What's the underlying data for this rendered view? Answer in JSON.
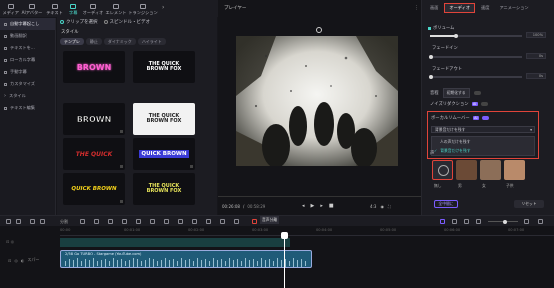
{
  "top_menu": [
    {
      "label": "メディア",
      "icon": "media-icon"
    },
    {
      "label": "AIアバター",
      "icon": "ai-avatar-icon"
    },
    {
      "label": "テキスト",
      "icon": "text-icon"
    },
    {
      "label": "字幕",
      "icon": "subtitle-icon"
    },
    {
      "label": "オーディオ",
      "icon": "audio-icon"
    },
    {
      "label": "エレメント",
      "icon": "element-icon"
    },
    {
      "label": "トランジション",
      "icon": "transition-icon"
    }
  ],
  "sidebar": {
    "items": [
      {
        "label": "自動字幕起こし"
      },
      {
        "label": "動画翻訳"
      },
      {
        "label": "テキストを..."
      },
      {
        "label": "ローカル字幕"
      },
      {
        "label": "手動字幕"
      },
      {
        "label": "カスタマイズ"
      },
      {
        "label": "スタイル"
      },
      {
        "label": "テキスト編集"
      }
    ]
  },
  "mid": {
    "radio_clip": "クリップを選択",
    "radio_speed": "スピンドル・ビデオ",
    "section_label": "スタイル",
    "filters": [
      "テンプレ",
      "静止",
      "ダイナミック",
      "ハイライト"
    ],
    "tiles": [
      {
        "text": "BROWN",
        "color": "#ff5fd1"
      },
      {
        "text": "THE QUICK BROWN FOX",
        "color": "#ffffff"
      },
      {
        "text": "BROWN",
        "color": "#ffffff"
      },
      {
        "text": "THE QUICK BROWN FOX",
        "color": "#222222"
      },
      {
        "text": "THE QUICK",
        "color": "#d22d2d"
      },
      {
        "text": "QUICK BROWN",
        "color": "#ffffff"
      },
      {
        "text": "QUICK BROWN",
        "color": "#f5d21a"
      },
      {
        "text": "THE QUICK BROWN FOX",
        "color": "#e7e45a"
      }
    ],
    "credits": "11/0233378",
    "apply_button": "適用を開始"
  },
  "player": {
    "title": "プレイヤー",
    "time_current": "00:26:08",
    "time_total": "00:58:29",
    "quality": "4:3"
  },
  "rpanel": {
    "tabs": [
      "画面",
      "オーディオ",
      "速度",
      "アニメーション"
    ],
    "active_tab": "オーディオ",
    "volume_label": "ボリューム",
    "volume_value": "100%",
    "fadein_label": "フェードイン",
    "fadein_value": "0s",
    "fadeout_label": "フェードアウト",
    "fadeout_value": "0s",
    "eq_label": "音程",
    "eq_button": "初期化する",
    "noise_label": "ノイズリダクション",
    "ai_badge": "AI",
    "vocal_label": "ボーカルリムーバー",
    "select_label": "背景音だけを残す",
    "options": [
      "人の声だけを残す",
      "背景音だけを残す"
    ],
    "selected_option": "背景音だけを残す",
    "voice_label": "声",
    "voices": [
      "無し",
      "男",
      "女",
      "子供"
    ],
    "bottom_buttons": [
      "全中間に",
      "リセット"
    ]
  },
  "timeline": {
    "tooltip": "音声分離",
    "track_label": "スパー",
    "clip_title": "2/58 Go TURBO - Stargame (YouTube.com)",
    "split_label": "分割",
    "ruler": [
      "00:00",
      "00:01:00",
      "00:02:00",
      "00:03:00",
      "00:04:00",
      "00:05:00",
      "00:06:00",
      "00:07:00"
    ]
  },
  "colors": {
    "accent": "#4ad6c9",
    "highlight": "#e0443a",
    "purple": "#7b5cff",
    "clip": "#1f5b78"
  }
}
